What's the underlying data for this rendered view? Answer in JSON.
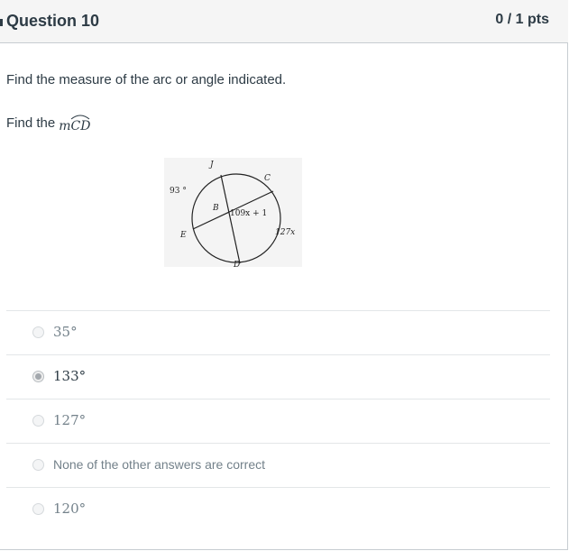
{
  "question": {
    "title": "Question 10",
    "points": "0 / 1 pts",
    "prompt": "Find the measure of the arc or angle indicated.",
    "find_text": "Find the",
    "find_math": "mCD"
  },
  "figure": {
    "labels": {
      "j": "J",
      "c": "C",
      "b": "B",
      "e": "E",
      "d": "D",
      "arc_je": "93 °",
      "angle": "109x + 1",
      "arc_cd": "127x"
    }
  },
  "answers": [
    {
      "label": "35°",
      "selected": false
    },
    {
      "label": "133°",
      "selected": true
    },
    {
      "label": "127°",
      "selected": false
    },
    {
      "label": "None of the other answers are correct",
      "selected": false
    },
    {
      "label": "120°",
      "selected": false
    }
  ]
}
